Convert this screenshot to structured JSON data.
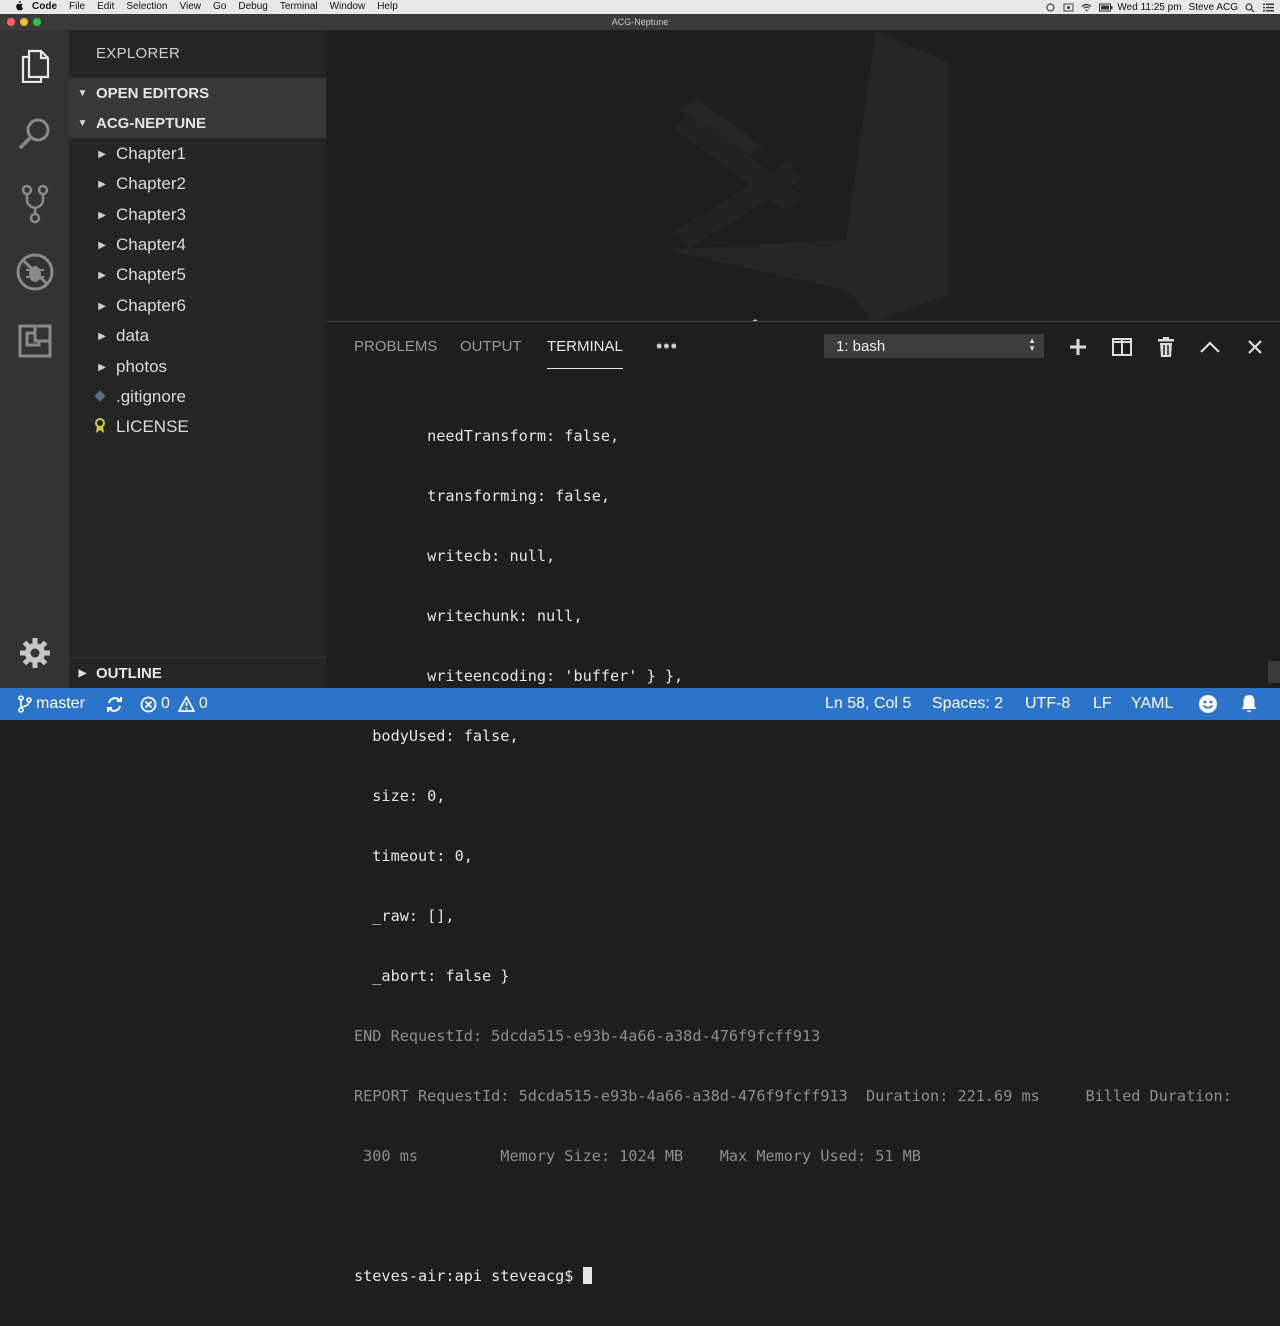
{
  "menubar": {
    "app": "Code",
    "items": [
      "File",
      "Edit",
      "Selection",
      "View",
      "Go",
      "Debug",
      "Terminal",
      "Window",
      "Help"
    ],
    "clock": "Wed 11:25 pm",
    "user": "Steve ACG"
  },
  "window": {
    "title": "ACG-Neptune"
  },
  "activity_bar": {
    "icons": [
      "files-icon",
      "search-icon",
      "source-control-icon",
      "debug-icon",
      "extensions-icon",
      "gear-icon"
    ]
  },
  "sidebar": {
    "title": "EXPLORER",
    "open_editors": "OPEN EDITORS",
    "project": "ACG-NEPTUNE",
    "folders": [
      "Chapter1",
      "Chapter2",
      "Chapter3",
      "Chapter4",
      "Chapter5",
      "Chapter6",
      "data",
      "photos"
    ],
    "files": [
      {
        "name": ".gitignore",
        "icon": "git-icon"
      },
      {
        "name": "LICENSE",
        "icon": "license-icon"
      }
    ],
    "outline": "OUTLINE"
  },
  "panel": {
    "tabs": [
      "PROBLEMS",
      "OUTPUT",
      "TERMINAL"
    ],
    "active_tab": "TERMINAL",
    "more": "•••",
    "terminal_select": "1: bash",
    "terminal_lines": [
      {
        "text": "        needTransform: false,",
        "dim": false
      },
      {
        "text": "        transforming: false,",
        "dim": false
      },
      {
        "text": "        writecb: null,",
        "dim": false
      },
      {
        "text": "        writechunk: null,",
        "dim": false
      },
      {
        "text": "        writeencoding: 'buffer' } },",
        "dim": false
      },
      {
        "text": "  bodyUsed: false,",
        "dim": false
      },
      {
        "text": "  size: 0,",
        "dim": false
      },
      {
        "text": "  timeout: 0,",
        "dim": false
      },
      {
        "text": "  _raw: [],",
        "dim": false
      },
      {
        "text": "  _abort: false }",
        "dim": false
      },
      {
        "text": "END RequestId: 5dcda515-e93b-4a66-a38d-476f9fcff913",
        "dim": true
      },
      {
        "text": "REPORT RequestId: 5dcda515-e93b-4a66-a38d-476f9fcff913  Duration: 221.69 ms     Billed Duration:",
        "dim": true
      },
      {
        "text": " 300 ms         Memory Size: 1024 MB    Max Memory Used: 51 MB",
        "dim": true
      },
      {
        "text": "",
        "dim": false
      }
    ],
    "prompt": "steves-air:api steveacg$ "
  },
  "statusbar": {
    "branch": "master",
    "errors": "0",
    "warnings": "0",
    "position": "Ln 58, Col 5",
    "spaces": "Spaces: 2",
    "encoding": "UTF-8",
    "eol": "LF",
    "language": "YAML"
  },
  "colors": {
    "statusbar": "#2c74c9",
    "activity": "#333333",
    "sidebar": "#252526",
    "editor": "#1e1e1e"
  }
}
